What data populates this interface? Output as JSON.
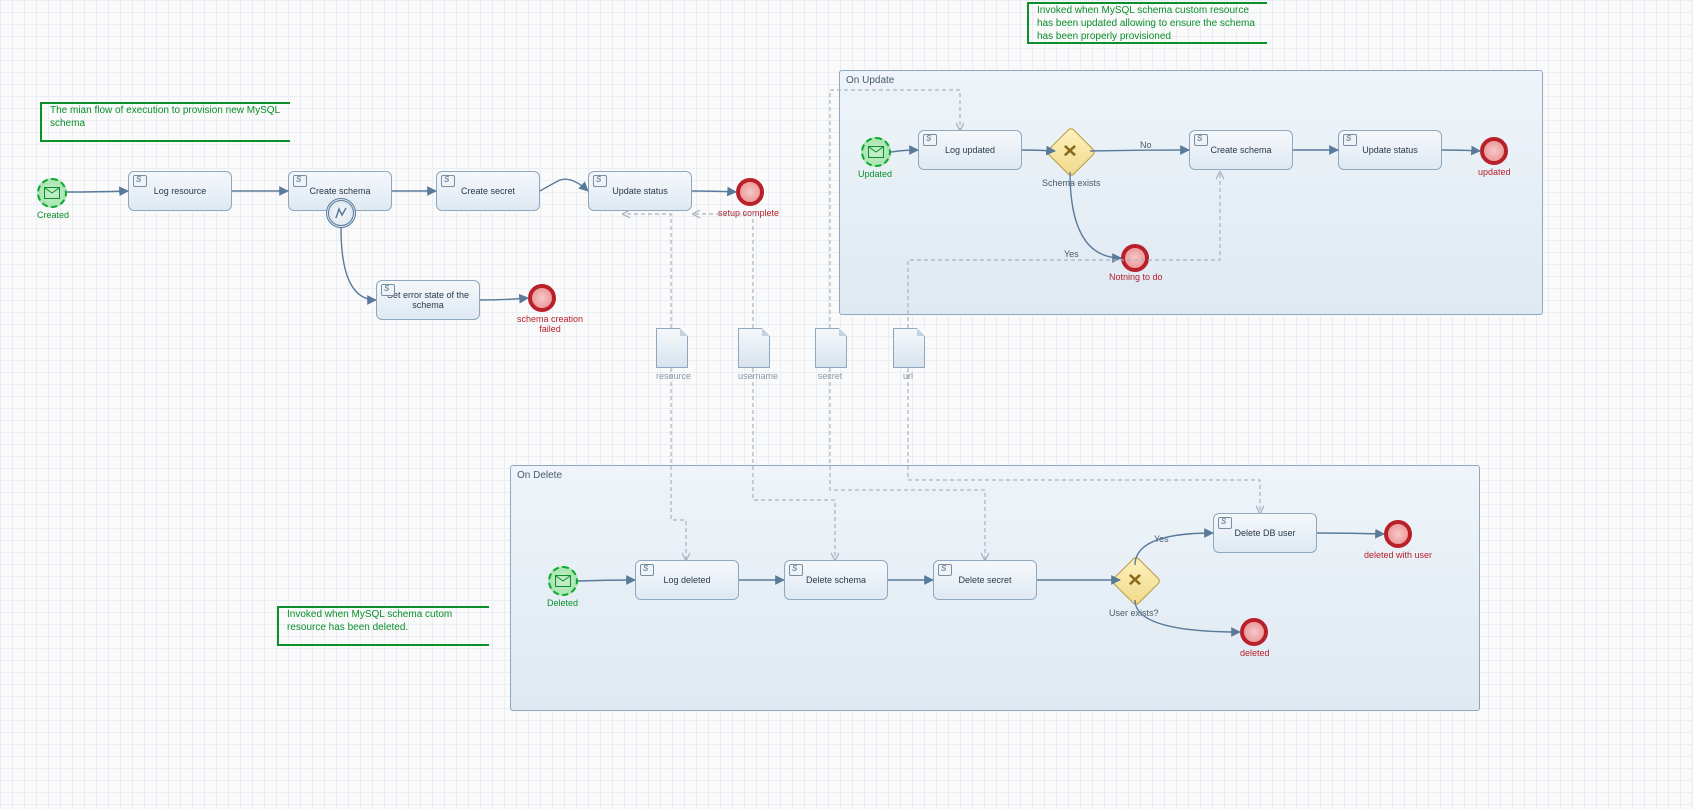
{
  "annotations": {
    "main": "The mian flow of execution to provision new MySQL schema",
    "onUpdate": "Invoked when MySQL schema custom resource has been updated allowing to ensure the schema has been properly provisioned",
    "onDelete": "Invoked when MySQL schema cutom resource has been deleted."
  },
  "pools": {
    "onUpdate": {
      "title": "On Update"
    },
    "onDelete": {
      "title": "On Delete"
    }
  },
  "mainFlow": {
    "start": "Created",
    "tasks": {
      "log": "Log resource",
      "createSchema": "Create schema",
      "createSecret": "Create secret",
      "updateStatus": "Update status",
      "setError": "Set error state of the schema"
    },
    "ends": {
      "complete": "setup complete",
      "failed": "schema creation failed"
    }
  },
  "updateFlow": {
    "start": "Updated",
    "tasks": {
      "log": "Log updated",
      "createSchema": "Create schema",
      "updateStatus": "Update status"
    },
    "gateway": {
      "label": "Schema exists",
      "no": "No",
      "yes": "Yes"
    },
    "ends": {
      "nothing": "Notning to do",
      "updated": "updated"
    }
  },
  "deleteFlow": {
    "start": "Deleted",
    "tasks": {
      "log": "Log deleted",
      "deleteSchema": "Delete schema",
      "deleteSecret": "Delete secret",
      "deleteUser": "Delete DB user"
    },
    "gateway": {
      "label": "User exists?",
      "yes": "Yes"
    },
    "ends": {
      "withUser": "deleted with user",
      "deleted": "deleted"
    }
  },
  "dataObjects": {
    "resource": "resource",
    "username": "username",
    "secret": "secret",
    "url": "url"
  }
}
